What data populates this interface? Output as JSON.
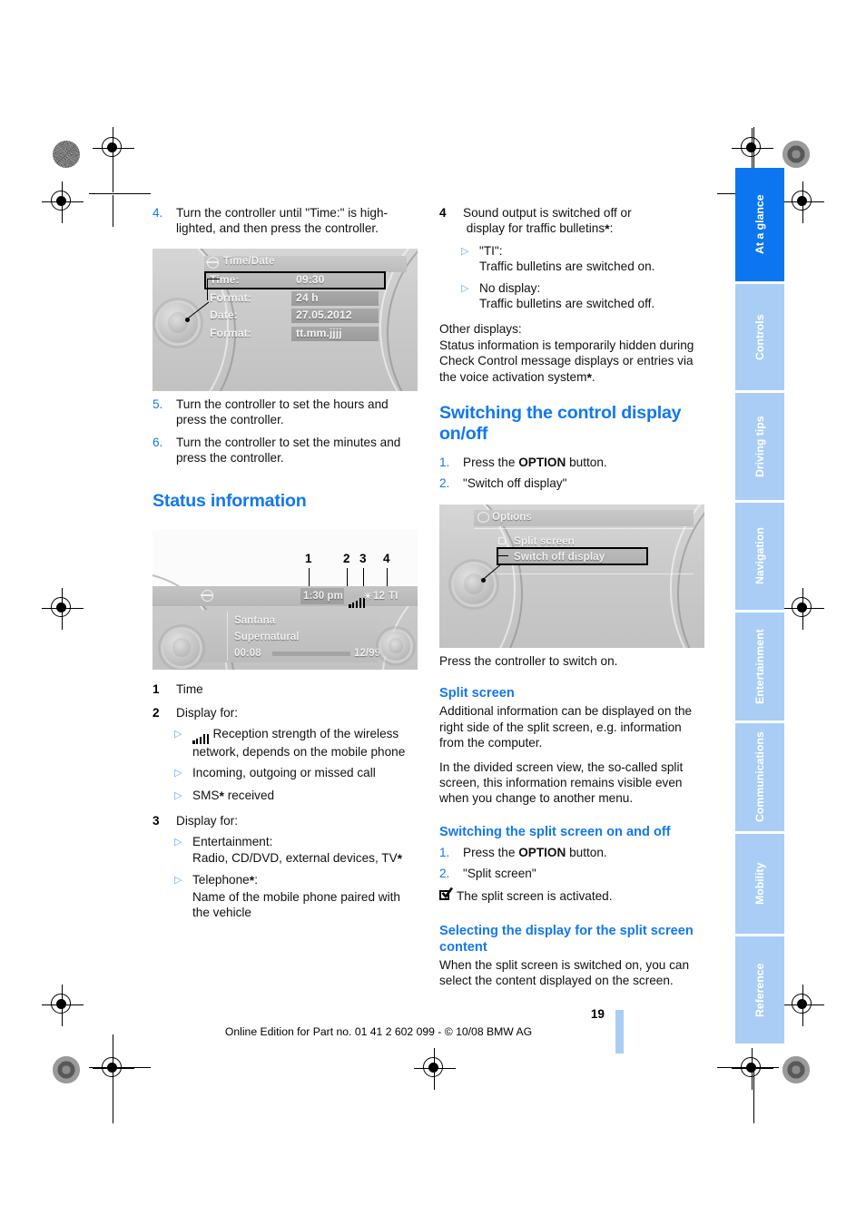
{
  "page": {
    "number": "19",
    "footer_note": "Online Edition for Part no. 01 41 2 602 099 - © 10/08 BMW AG"
  },
  "colors": {
    "heading_blue": "#1277f0",
    "tab_active_blue": "#0b76f0",
    "tab_inactive_blue": "#aacdf5",
    "bullet_blue": "#5fa8f5"
  },
  "sidebar": {
    "tabs": [
      {
        "label": "At a glance",
        "active": true
      },
      {
        "label": "Controls",
        "active": false
      },
      {
        "label": "Driving tips",
        "active": false
      },
      {
        "label": "Navigation",
        "active": false
      },
      {
        "label": "Entertainment",
        "active": false
      },
      {
        "label": "Communications",
        "active": false
      },
      {
        "label": "Mobility",
        "active": false
      },
      {
        "label": "Reference",
        "active": false
      }
    ]
  },
  "left_column": {
    "step4": {
      "num": "4.",
      "text": "Turn the controller until \"Time:\" is high-lighted, and then press the controller."
    },
    "step5": {
      "num": "5.",
      "text": "Turn the controller to set the hours and press the controller."
    },
    "step6": {
      "num": "6.",
      "text": "Turn the controller to set the minutes and press the controller."
    },
    "figure_timedate": {
      "title": "Time/Date",
      "rows": [
        {
          "label": "Time:",
          "value": "09:30",
          "selected": true
        },
        {
          "label": "Format:",
          "value": "24 h",
          "selected": false
        },
        {
          "label": "Date:",
          "value": "27.05.2012",
          "selected": false
        },
        {
          "label": "Format:",
          "value": "tt.mm.jjjj",
          "selected": false
        }
      ]
    },
    "heading_status": "Status information",
    "figure_status": {
      "callouts": [
        "1",
        "2",
        "3",
        "4"
      ],
      "status_bar": {
        "time": "1:30 pm",
        "reception": "signal-bars-icon",
        "temp": "12",
        "ti": "TI"
      },
      "now_playing": {
        "artist": "Santana",
        "track": "Supernatural",
        "elapsed": "00:08",
        "track_count": "12/99"
      }
    },
    "legend": [
      {
        "num": "1",
        "title": "Time",
        "items": []
      },
      {
        "num": "2",
        "title": "Display for:",
        "items": [
          {
            "icon": "signal-bars-icon",
            "text": "Reception strength of the wireless network, depends on the mobile phone"
          },
          {
            "icon": "",
            "text": "Incoming, outgoing or missed call"
          },
          {
            "icon": "",
            "text": "SMS* received"
          }
        ]
      },
      {
        "num": "3",
        "title": "Display for:",
        "items": [
          {
            "icon": "",
            "text": "Entertainment:\nRadio, CD/DVD, external devices, TV*"
          },
          {
            "icon": "",
            "text": "Telephone*:\nName of the mobile phone paired with the vehicle"
          }
        ]
      }
    ]
  },
  "right_column": {
    "legend4": {
      "num": "4",
      "title": "Sound output is switched off or display for traffic bulletins*:",
      "items": [
        {
          "text": "\"TI\":\nTraffic bulletins are switched on."
        },
        {
          "text": "No display:\nTraffic bulletins are switched off."
        }
      ]
    },
    "other_displays_label": "Other displays:",
    "other_displays_text": "Status information is temporarily hidden during Check Control message displays or entries via the voice activation system*.",
    "heading_switching_control_display": "Switching the control display on/off",
    "steps_control_display": [
      {
        "num": "1.",
        "text_pre": "Press the ",
        "text_bold": "OPTION",
        "text_post": " button."
      },
      {
        "num": "2.",
        "text_pre": "\"Switch off display\"",
        "text_bold": "",
        "text_post": ""
      }
    ],
    "figure_options": {
      "title": "Options",
      "items": [
        {
          "label": "Split screen",
          "checkbox": true,
          "selected": false
        },
        {
          "label": "Switch off display",
          "checkbox": false,
          "selected": true
        }
      ]
    },
    "press_controller_text": "Press the controller to switch on.",
    "heading_split_screen": "Split screen",
    "split_screen_para1": "Additional information can be displayed on the right side of the split screen, e.g. information from the computer.",
    "split_screen_para2": "In the divided screen view, the so-called split screen, this information remains visible even when you change to another menu.",
    "heading_switching_split": "Switching the split screen on and off",
    "steps_split": [
      {
        "num": "1.",
        "text_pre": "Press the ",
        "text_bold": "OPTION",
        "text_post": " button."
      },
      {
        "num": "2.",
        "text_pre": "\"Split screen\"",
        "text_bold": "",
        "text_post": ""
      }
    ],
    "split_activated_text": "The split screen is activated.",
    "heading_selecting_display": "Selecting the display for the split screen content",
    "selecting_display_text": "When the split screen is switched on, you can select the content displayed on the screen."
  }
}
